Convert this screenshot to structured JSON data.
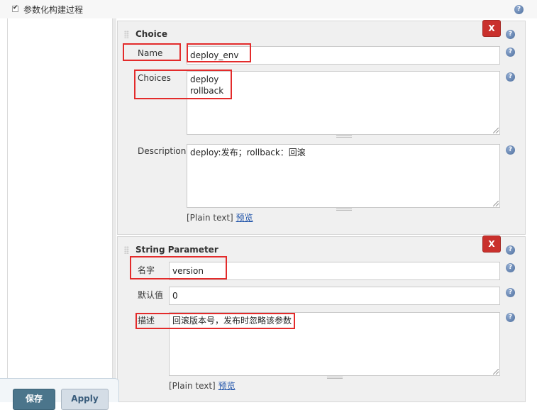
{
  "top": {
    "label": "参数化构建过程",
    "checked": true
  },
  "help_glyph": "?",
  "choice_param": {
    "title": "Choice",
    "delete_label": "X",
    "name_label": "Name",
    "name_value": "deploy_env",
    "choices_label": "Choices",
    "choices_value": "deploy\nrollback",
    "description_label": "Description",
    "description_value": "deploy:发布；rollback：回滚",
    "plain_text": "[Plain text]",
    "preview_link": "预览"
  },
  "string_param": {
    "title": "String Parameter",
    "delete_label": "X",
    "name_label": "名字",
    "name_value": "version",
    "default_label": "默认值",
    "default_value": "0",
    "description_label": "描述",
    "description_value": "回滚版本号，发布时忽略该参数",
    "plain_text": "[Plain text]",
    "preview_link": "预览"
  },
  "buttons": {
    "save_label": "保存",
    "apply_label": "Apply"
  },
  "colors": {
    "delete": "#c9302c",
    "annotation": "#e32b2b",
    "save": "#4b758b",
    "link": "#2255aa"
  }
}
